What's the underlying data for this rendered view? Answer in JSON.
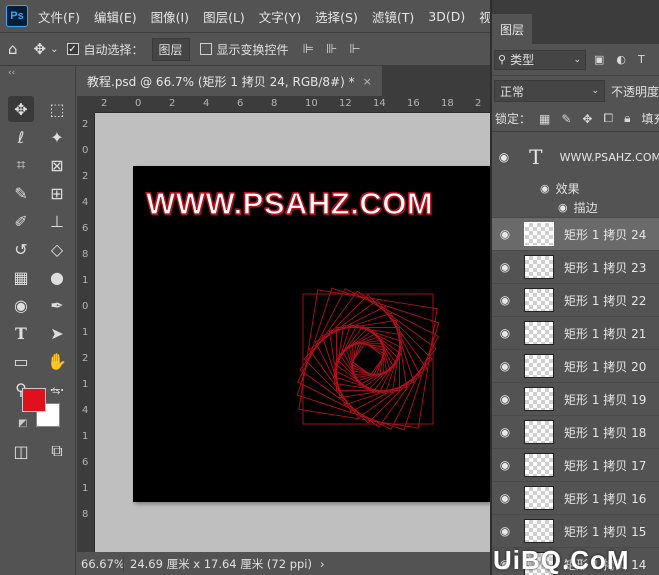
{
  "menubar": {
    "logo": "Ps",
    "items": [
      "文件(F)",
      "编辑(E)",
      "图像(I)",
      "图层(L)",
      "文字(Y)",
      "选择(S)",
      "滤镜(T)",
      "3D(D)",
      "视图(V)",
      "窗"
    ]
  },
  "options": {
    "auto_select_label": "自动选择：",
    "auto_select_value": "图层",
    "show_transform_label": "显示变换控件"
  },
  "tools": {
    "collapse": "‹‹"
  },
  "document": {
    "tab_title": "教程.psd @ 66.7% (矩形 1 拷贝 24, RGB/8#) *",
    "close": "×",
    "canvas_text": "WWW.PSAHZ.COM"
  },
  "rulers": {
    "h_ticks": [
      "2",
      "0",
      "2",
      "4",
      "6",
      "8",
      "10",
      "12",
      "14",
      "16",
      "18",
      "2"
    ],
    "v_ticks": [
      "2",
      "0",
      "2",
      "4",
      "6",
      "8",
      "1",
      "0",
      "1",
      "2",
      "1",
      "4",
      "1",
      "6",
      "1",
      "8"
    ]
  },
  "status": {
    "zoom": "66.67%",
    "doc_size": "24.69 厘米 x 17.64 厘米 (72 ppi)",
    "arrow": "›"
  },
  "layers_panel": {
    "tab": "图层",
    "filter_label": "类型",
    "blend_mode": "正常",
    "opacity_label": "不透明度",
    "lock_label": "锁定：",
    "fill_label": "填充",
    "text_layer": {
      "name": "WWW.PSAHZ.COM",
      "effects_label": "效果",
      "stroke_label": "描边"
    },
    "layers": [
      {
        "name": "矩形 1 拷贝 24",
        "selected": true
      },
      {
        "name": "矩形 1 拷贝 23"
      },
      {
        "name": "矩形 1 拷贝 22"
      },
      {
        "name": "矩形 1 拷贝 21"
      },
      {
        "name": "矩形 1 拷贝 20"
      },
      {
        "name": "矩形 1 拷贝 19"
      },
      {
        "name": "矩形 1 拷贝 18"
      },
      {
        "name": "矩形 1 拷贝 17"
      },
      {
        "name": "矩形 1 拷贝 16"
      },
      {
        "name": "矩形 1 拷贝 15"
      },
      {
        "name": "矩形 1 拷贝 14"
      }
    ]
  },
  "colors": {
    "foreground": "#e0101d",
    "background": "#ffffff",
    "spiral_stroke": "#b3101c"
  },
  "watermark": "UiBQ.CoM"
}
